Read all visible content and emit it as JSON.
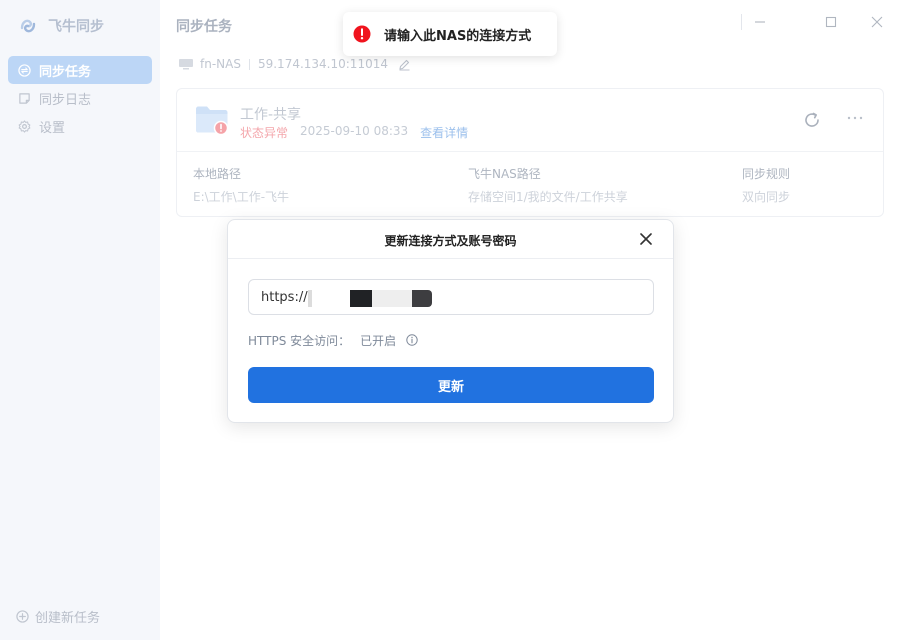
{
  "app": {
    "name": "飞牛同步"
  },
  "sidebar": {
    "items": [
      {
        "label": "同步任务",
        "icon": "sync-icon",
        "active": true
      },
      {
        "label": "同步日志",
        "icon": "log-icon",
        "active": false
      },
      {
        "label": "设置",
        "icon": "gear-icon",
        "active": false
      }
    ],
    "create_label": "创建新任务"
  },
  "header": {
    "title": "同步任务"
  },
  "device": {
    "name": "fn-NAS",
    "address": "59.174.134.10:11014"
  },
  "task": {
    "name": "工作-共享",
    "status": "状态异常",
    "time": "2025-09-10 08:33",
    "details_link": "查看详情",
    "local_path_label": "本地路径",
    "local_path": "E:\\工作\\工作-飞牛",
    "nas_path_label": "飞牛NAS路径",
    "nas_path": "存储空间1/我的文件/工作共享",
    "rule_label": "同步规则",
    "rule": "双向同步"
  },
  "toast": {
    "message": "请输入此NAS的连接方式"
  },
  "modal": {
    "title": "更新连接方式及账号密码",
    "url_value": "https://                          3/",
    "https_label": "HTTPS 安全访问：",
    "https_value": "已开启",
    "update_label": "更新"
  },
  "colors": {
    "accent": "#2172e0",
    "error": "#f0141e",
    "sidebar_active": "#bcd6f6"
  }
}
